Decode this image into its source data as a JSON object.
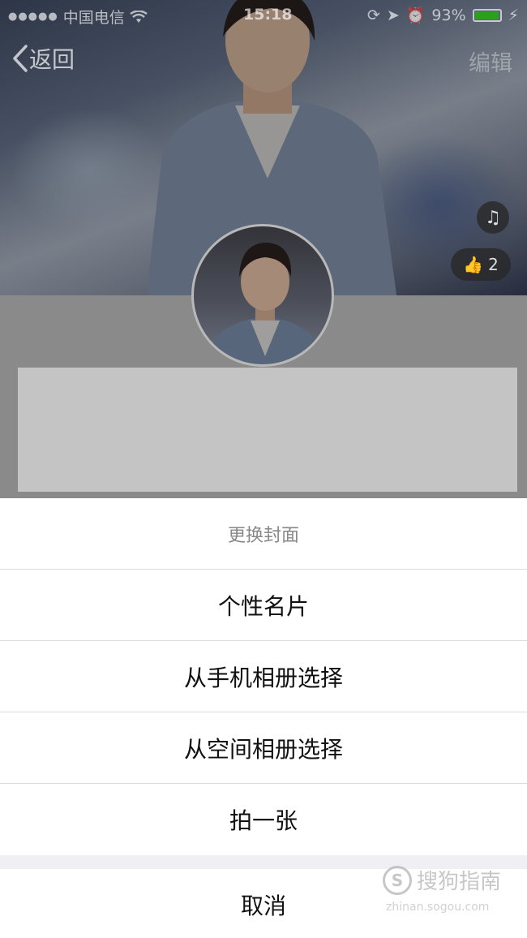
{
  "status_bar": {
    "signal": "●●●●●",
    "carrier": "中国电信",
    "time": "15:18",
    "battery_percent": "93%",
    "battery_level": 0.93
  },
  "nav": {
    "back_label": "返回",
    "edit_label": "编辑"
  },
  "cover": {
    "like_count": "2"
  },
  "action_sheet": {
    "title": "更换封面",
    "items": [
      {
        "label": "个性名片"
      },
      {
        "label": "从手机相册选择"
      },
      {
        "label": "从空间相册选择"
      },
      {
        "label": "拍一张"
      }
    ],
    "cancel_label": "取消"
  },
  "watermark": {
    "logo_letter": "S",
    "text": "搜狗指南",
    "url": "zhinan.sogou.com"
  },
  "colors": {
    "battery": "#2ca01c",
    "sheet_background": "#efeff4"
  }
}
